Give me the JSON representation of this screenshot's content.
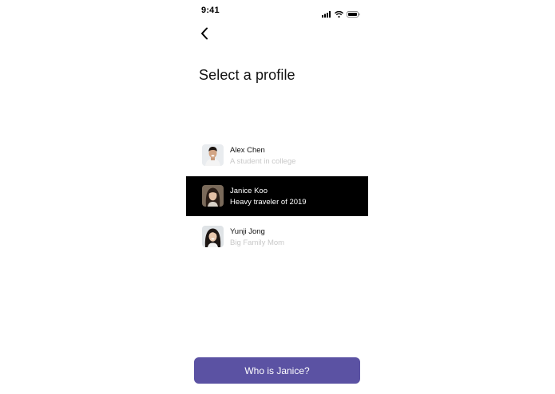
{
  "status_bar": {
    "time": "9:41",
    "icons": [
      "signal-icon",
      "wifi-icon",
      "battery-icon"
    ]
  },
  "header": {
    "back_icon": "chevron-left-icon",
    "title": "Select a profile"
  },
  "profiles": [
    {
      "name": "Alex Chen",
      "description": "A student in college",
      "selected": false
    },
    {
      "name": "Janice Koo",
      "description": "Heavy traveler of 2019",
      "selected": true
    },
    {
      "name": "Yunji Jong",
      "description": "Big Family Mom",
      "selected": false
    }
  ],
  "cta": {
    "label": "Who is Janice?"
  },
  "colors": {
    "accent": "#5b52a3",
    "selected_row": "#000000",
    "muted_text": "#c8c8c8"
  }
}
